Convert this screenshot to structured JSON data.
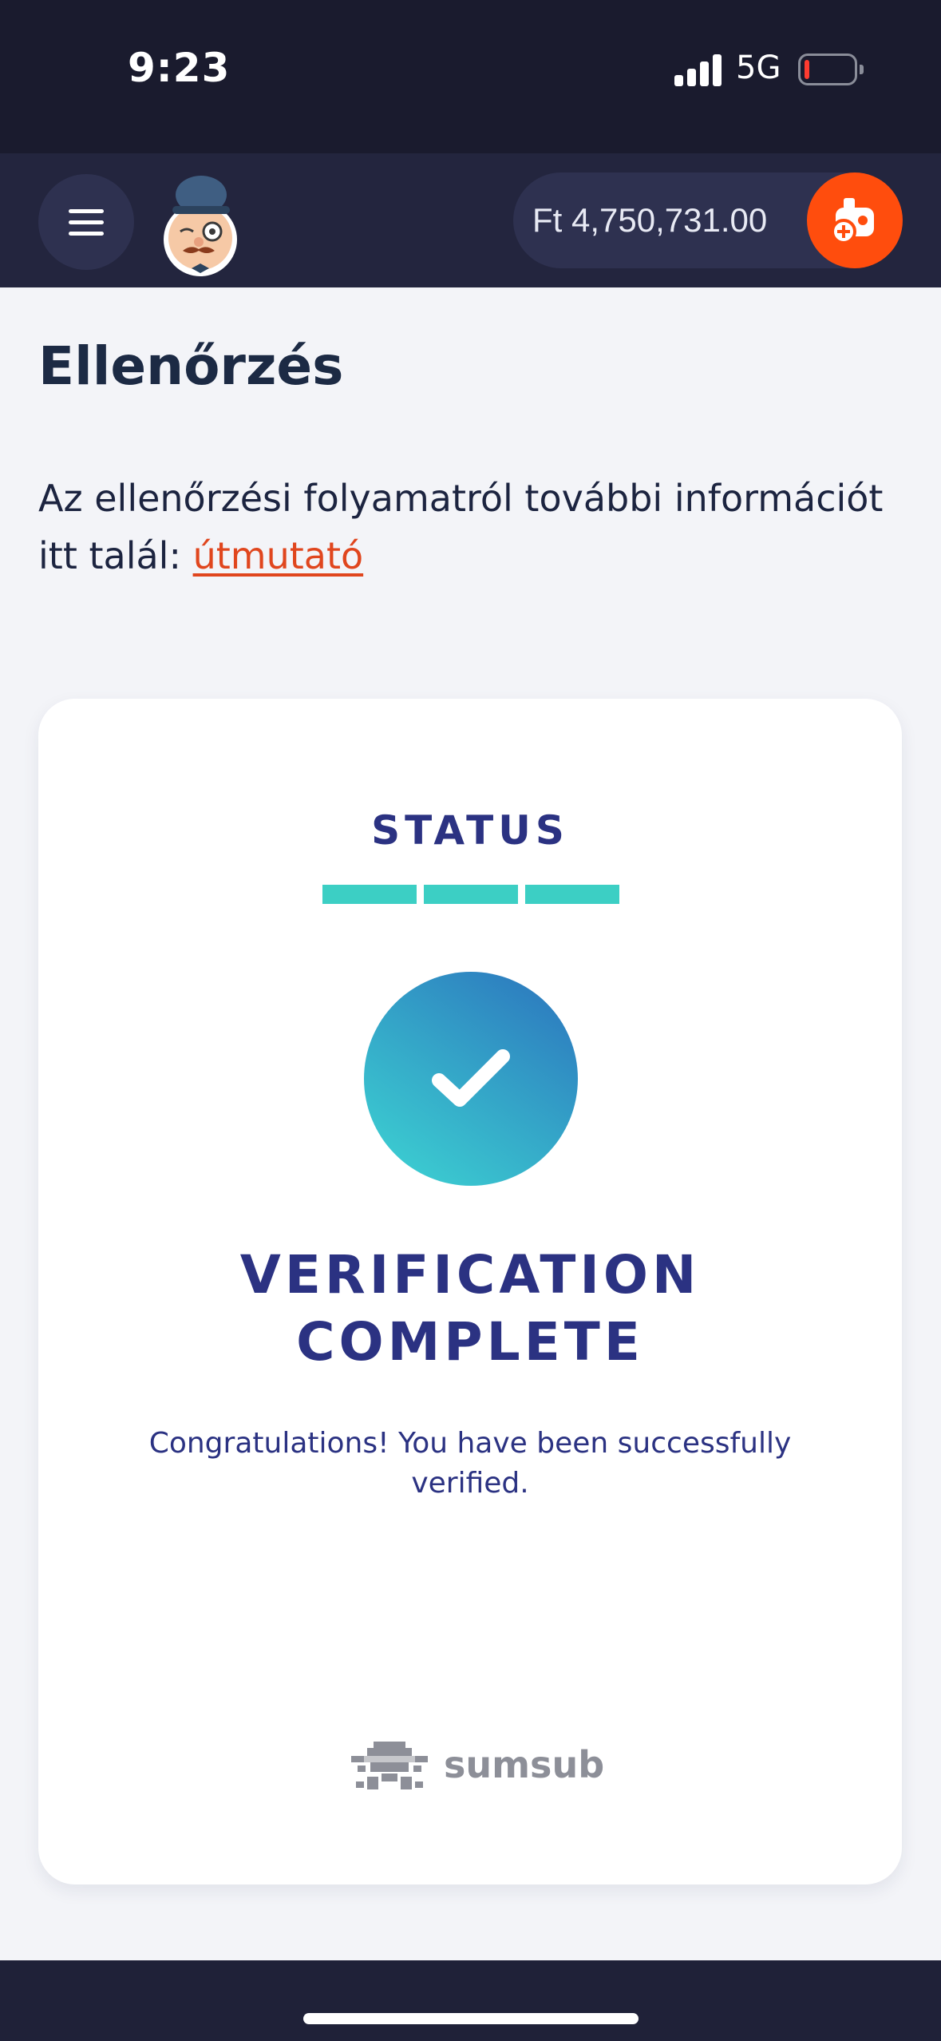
{
  "status_bar": {
    "time": "9:23",
    "network": "5G",
    "battery_level": 0.1
  },
  "header": {
    "menu_icon": "hamburger-menu-icon",
    "mascot_icon": "monocle-gentleman-mascot",
    "balance": "Ft 4,750,731.00",
    "deposit_icon": "game-console-plus-icon"
  },
  "page": {
    "title": "Ellenőrzés",
    "intro_text": "Az ellenőrzési folyamatról további információt itt talál: ",
    "guide_link": "útmutató"
  },
  "verification_card": {
    "status_label": "STATUS",
    "progress_steps_completed": 3,
    "progress_steps_total": 3,
    "status_icon": "checkmark-icon",
    "headline": "VERIFICATION COMPLETE",
    "message": "Congratulations! You have been successfully verified.",
    "provider": "sumsub"
  },
  "colors": {
    "accent_orange": "#ff4d0d",
    "link": "#e0461e",
    "progress": "#3ccfc4",
    "heading_navy": "#2b3282",
    "header_bg": "#23253e"
  }
}
